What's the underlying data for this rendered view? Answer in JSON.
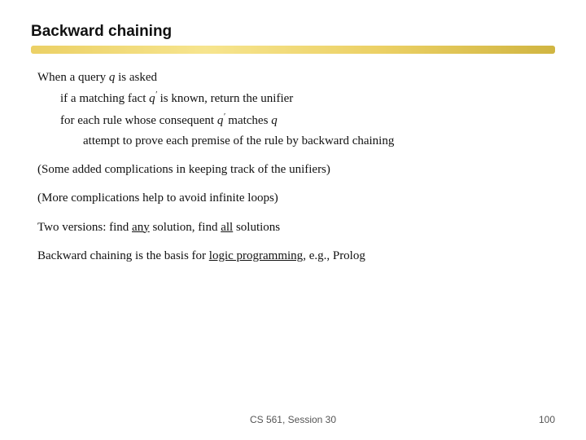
{
  "title": "Backward chaining",
  "content": {
    "line1": "When a query ",
    "q1": "q",
    "line1b": " is asked",
    "line2_prefix": "if a ",
    "line2_match": "matching fact",
    "line2_math": "q′",
    "line2_suffix": " is known, return the unifier",
    "line3_prefix": "for each rule whose consequent ",
    "line3_math": "q′",
    "line3_matches": " matches ",
    "line3_q": "q",
    "line4": "attempt to prove each premise of the rule by backward chaining",
    "line5": "(Some added complications in keeping track of the unifiers)",
    "line6": "(More complications help to avoid infinite loops)",
    "line7_prefix": "Two versions: find ",
    "line7_any": "any",
    "line7_mid": " solution, find ",
    "line7_all": "all",
    "line7_suffix": " solutions",
    "line8_prefix": "Backward chaining is the basis for ",
    "line8_link": "logic programming",
    "line8_suffix": ", e.g., Prolog"
  },
  "footer": {
    "session": "CS 561, Session 30",
    "page": "100"
  }
}
